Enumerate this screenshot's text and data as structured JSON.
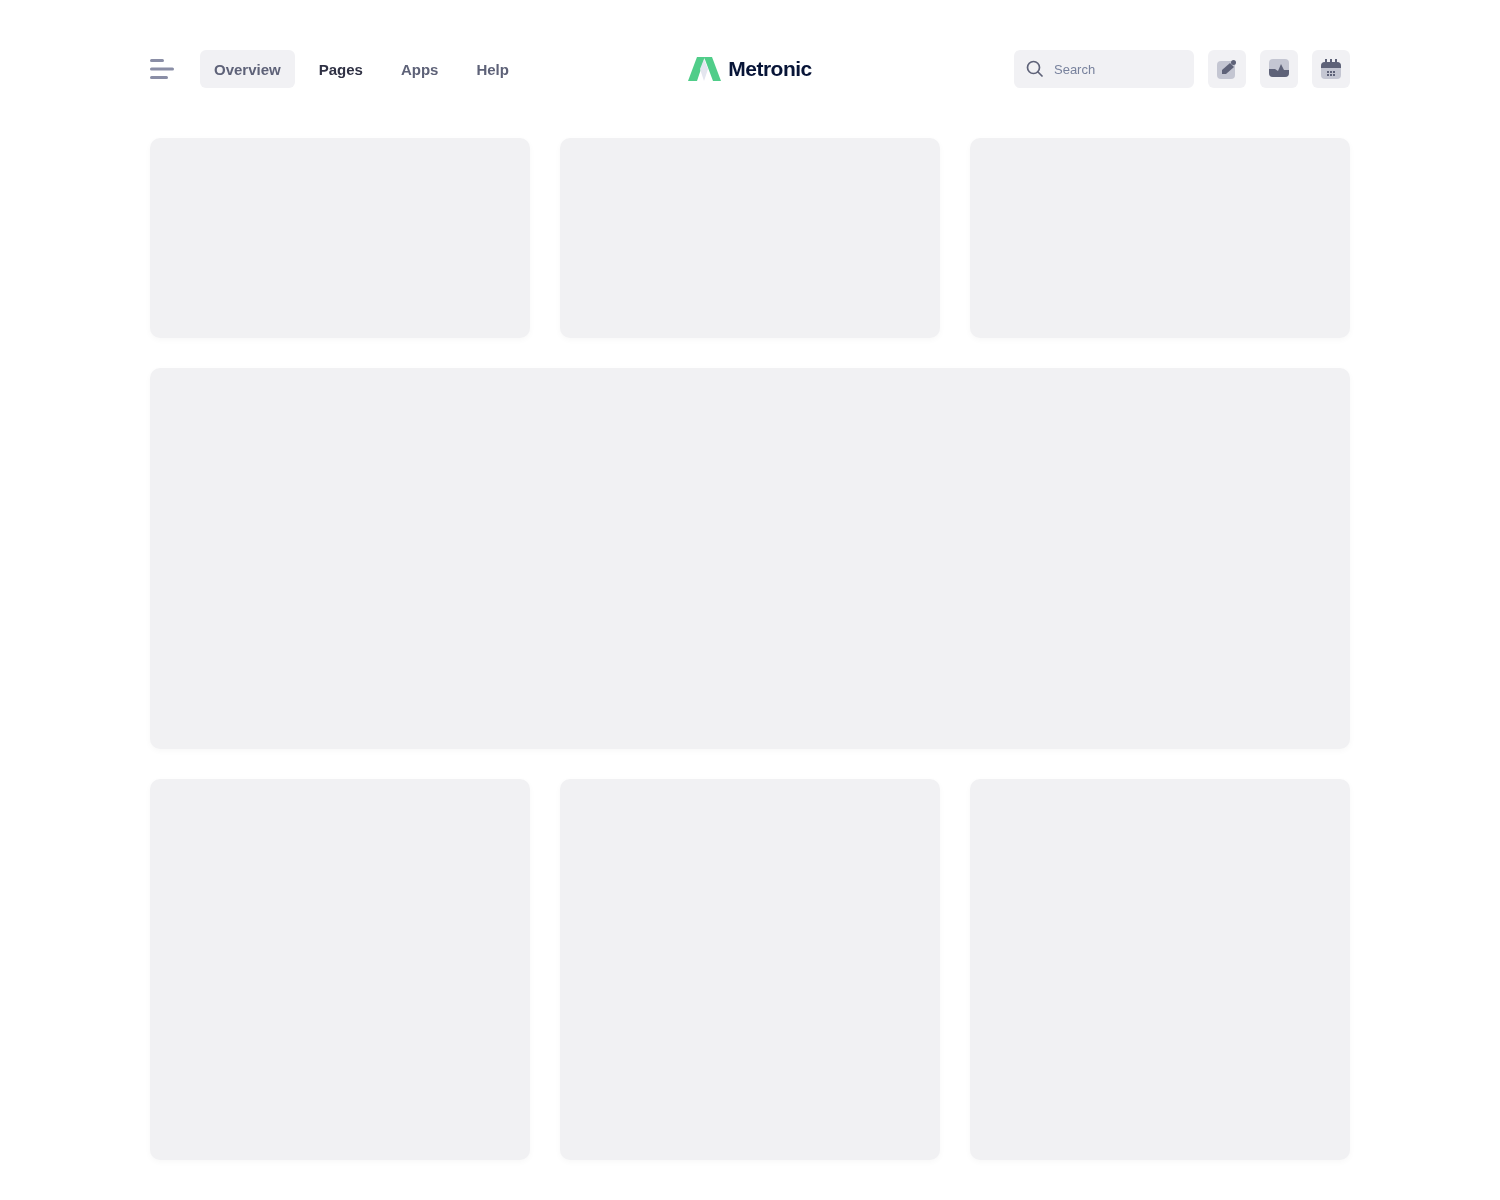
{
  "nav": [
    {
      "label": "Overview",
      "selected": true,
      "emphasized": false
    },
    {
      "label": "Pages",
      "selected": false,
      "emphasized": true
    },
    {
      "label": "Apps",
      "selected": false,
      "emphasized": false
    },
    {
      "label": "Help",
      "selected": false,
      "emphasized": false
    }
  ],
  "logo": {
    "text": "Metronic"
  },
  "search": {
    "placeholder": "Search"
  },
  "toolbar": [
    {
      "kind": "edit"
    },
    {
      "kind": "chart"
    },
    {
      "kind": "calendar"
    }
  ],
  "sections": [
    {
      "kind": "short-row"
    },
    {
      "kind": "wide"
    },
    {
      "kind": "tall-row"
    }
  ]
}
